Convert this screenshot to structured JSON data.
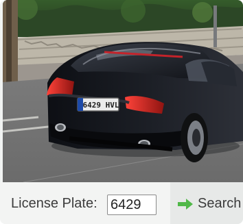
{
  "photo": {
    "plate_text": "6429 HVL",
    "subject": "car-photo"
  },
  "search": {
    "label": "License Plate:",
    "value": "6429",
    "button_label": "Search",
    "button_icon": "arrow-right-icon",
    "icon_color": "#50b848"
  }
}
